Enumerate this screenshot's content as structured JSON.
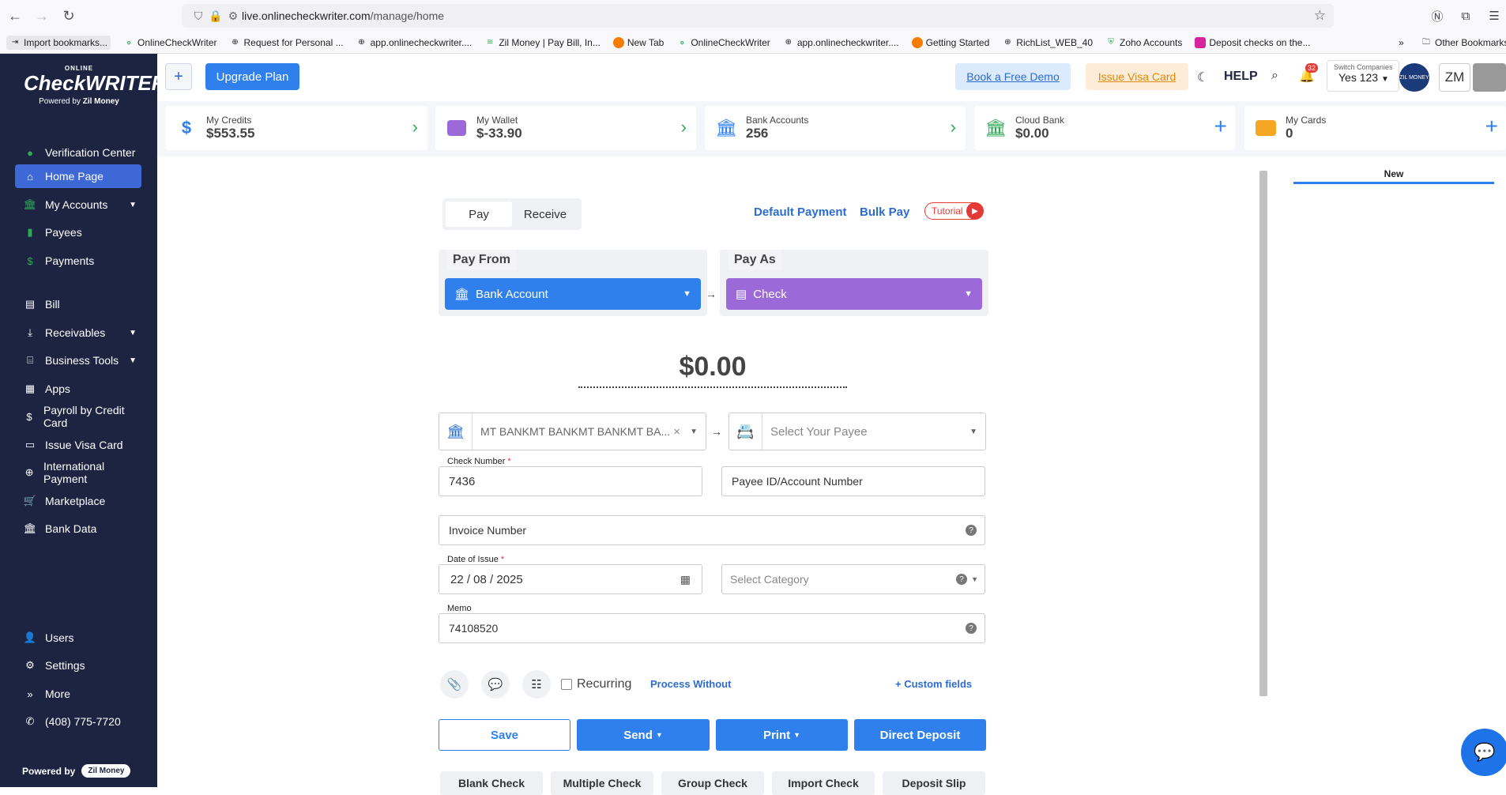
{
  "browser": {
    "url_domain": "live.onlinecheckwriter.com",
    "url_path": "/manage/home"
  },
  "bookmarks": [
    {
      "label": "Import bookmarks...",
      "icon": "import-icon"
    },
    {
      "label": "OnlineCheckWriter",
      "icon": "ocw-icon"
    },
    {
      "label": "Request for Personal ...",
      "icon": "globe-icon"
    },
    {
      "label": "app.onlinecheckwriter....",
      "icon": "globe-icon"
    },
    {
      "label": "Zil Money | Pay Bill, In...",
      "icon": "zil-icon"
    },
    {
      "label": "New Tab",
      "icon": "firefox-icon"
    },
    {
      "label": "OnlineCheckWriter",
      "icon": "ocw-icon"
    },
    {
      "label": "app.onlinecheckwriter....",
      "icon": "globe-icon"
    },
    {
      "label": "Getting Started",
      "icon": "firefox-icon"
    },
    {
      "label": "RichList_WEB_40",
      "icon": "globe-icon"
    },
    {
      "label": "Zoho Accounts",
      "icon": "zoho-icon"
    },
    {
      "label": "Deposit checks on the...",
      "icon": "instagram-icon"
    }
  ],
  "other_bookmarks": "Other Bookmarks",
  "logo": {
    "small": "ONLINE",
    "big": "CheckWRITER",
    "powered": "Powered by",
    "brand": "Zil Money"
  },
  "sidebar": {
    "items": [
      {
        "label": "Verification Center",
        "icon": "check-circle-icon"
      },
      {
        "label": "Home Page",
        "icon": "home-icon"
      },
      {
        "label": "My Accounts",
        "icon": "bank-icon"
      },
      {
        "label": "Payees",
        "icon": "contact-icon"
      },
      {
        "label": "Payments",
        "icon": "dollar-icon"
      },
      {
        "label": "Bill",
        "icon": "bill-icon"
      },
      {
        "label": "Receivables",
        "icon": "receive-icon"
      },
      {
        "label": "Business Tools",
        "icon": "toolbox-icon"
      },
      {
        "label": "Apps",
        "icon": "apps-icon"
      },
      {
        "label": "Payroll by Credit Card",
        "icon": "dollar-icon"
      },
      {
        "label": "Issue Visa Card",
        "icon": "card-icon"
      },
      {
        "label": "International Payment",
        "icon": "globe-icon"
      },
      {
        "label": "Marketplace",
        "icon": "cart-icon"
      },
      {
        "label": "Bank Data",
        "icon": "bank-icon"
      }
    ],
    "bottom": [
      {
        "label": "Users",
        "icon": "user-icon"
      },
      {
        "label": "Settings",
        "icon": "gear-icon"
      },
      {
        "label": "More",
        "icon": "chevrons-right-icon"
      },
      {
        "label": "(408) 775-7720",
        "icon": "phone-icon"
      }
    ],
    "powered_by": "Powered by",
    "powered_brand": "Zil Money"
  },
  "topbar": {
    "upgrade": "Upgrade Plan",
    "demo": "Book a Free Demo",
    "visa": "Issue Visa Card",
    "help": "HELP",
    "bell_count": "32",
    "switch_label": "Switch Companies",
    "switch_value": "Yes 123",
    "avatar_text": "ZIL MONEY",
    "initials": "ZM"
  },
  "cards": [
    {
      "title": "My Credits",
      "value": "$553.55",
      "icon": "dollar-icon",
      "color": "#2f80ed"
    },
    {
      "title": "My Wallet",
      "value": "$-33.90",
      "icon": "wallet-icon",
      "color": "#9b6ad8"
    },
    {
      "title": "Bank Accounts",
      "value": "256",
      "icon": "bank-icon",
      "color": "#2f80ed"
    },
    {
      "title": "Cloud Bank",
      "value": "$0.00",
      "icon": "bank-icon",
      "color": "#2eaa56"
    },
    {
      "title": "My Cards",
      "value": "0",
      "icon": "card-icon",
      "color": "#f5a623"
    }
  ],
  "right_panel": {
    "tab": "New"
  },
  "form": {
    "tab_pay": "Pay",
    "tab_receive": "Receive",
    "default_payment": "Default Payment",
    "bulk_pay": "Bulk Pay",
    "tutorial": "Tutorial",
    "pay_from_label": "Pay From",
    "pay_from_value": "Bank Account",
    "pay_as_label": "Pay As",
    "pay_as_value": "Check",
    "amount": "$0.00",
    "bank_value": "MT BANKMT BANKMT BANKMT BA...",
    "payee_placeholder": "Select Your Payee",
    "check_number_label": "Check Number",
    "check_number": "7436",
    "payee_id_placeholder": "Payee ID/Account Number",
    "invoice_placeholder": "Invoice Number",
    "date_label": "Date of Issue",
    "date_value": "22 / 08 / 2025",
    "category_placeholder": "Select Category",
    "memo_label": "Memo",
    "memo_value": "74108520",
    "recurring": "Recurring",
    "process_without": "Process Without",
    "custom_fields": "+ Custom fields",
    "save": "Save",
    "send": "Send",
    "print": "Print",
    "direct_deposit": "Direct Deposit",
    "bottom_buttons": [
      "Blank Check",
      "Multiple Check",
      "Group Check",
      "Import Check",
      "Deposit Slip"
    ]
  },
  "colors": {
    "sidebar": "#1d2442",
    "accent": "#2f80ed",
    "pay_as": "#9b6ad8"
  }
}
